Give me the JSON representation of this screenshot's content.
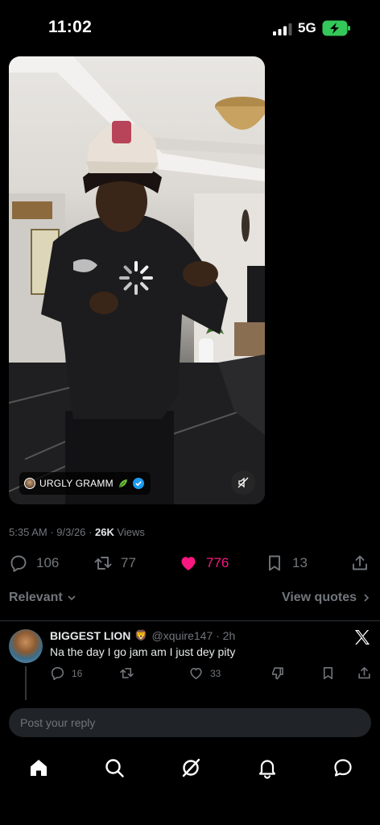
{
  "status_bar": {
    "time": "11:02",
    "network": "5G",
    "icons": [
      "signal-icon",
      "battery-charging-icon"
    ]
  },
  "media": {
    "author_name": "URGLY GRAMM",
    "author_emoji": "🌿",
    "icons": [
      "loading-spinner-icon",
      "leaf-icon",
      "verified-badge-icon",
      "mute-icon"
    ],
    "colors": {
      "verified": "#1d9bf0"
    }
  },
  "tweet_meta": {
    "time": "5:35 AM",
    "separator": " · ",
    "date": "9/3/26",
    "views_count": "26K",
    "views_label": " Views"
  },
  "actions": {
    "replies": "106",
    "retweets": "77",
    "likes": "776",
    "bookmarks": "13",
    "liked": true,
    "colors": {
      "like_active": "#f91880",
      "muted": "#71767b"
    },
    "icons": [
      "reply-icon",
      "retweet-icon",
      "heart-icon",
      "bookmark-icon",
      "share-icon"
    ]
  },
  "sort": {
    "label": "Relevant",
    "view_quotes": "View quotes",
    "icons": [
      "chevron-down-icon",
      "chevron-right-icon"
    ]
  },
  "reply": {
    "name": "BIGGEST LION",
    "name_emoji": "🦁",
    "handle": "@xquire147 · 2h",
    "text": "Na the day I go jam am I just dey pity",
    "reply_count": "16",
    "retweet_count": "",
    "like_count": "33",
    "icons": [
      "x-logo-icon",
      "reply-icon",
      "retweet-icon",
      "heart-icon",
      "dislike-icon",
      "bookmark-icon",
      "share-icon"
    ]
  },
  "composer": {
    "placeholder": "Post your reply"
  },
  "tab_bar": {
    "active_tab": "home",
    "icons": [
      "home-icon",
      "search-icon",
      "grok-icon",
      "notifications-icon",
      "messages-icon"
    ]
  }
}
